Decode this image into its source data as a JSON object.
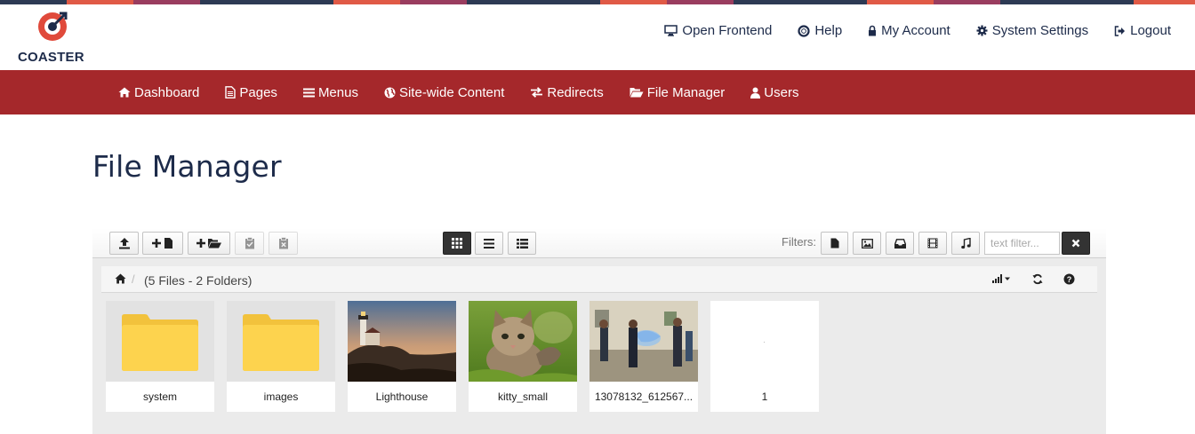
{
  "brand": {
    "logo_text": "COASTER",
    "stripe_colors": [
      "#2d3a54",
      "#e05a46",
      "#9a3d5f",
      "#2d3a54",
      "#2d3a54",
      "#e05a46",
      "#9a3d5f",
      "#2d3a54",
      "#2d3a54",
      "#e05a46",
      "#9a3d5f",
      "#2d3a54",
      "#2d3a54",
      "#e05a46",
      "#9a3d5f",
      "#2d3a54",
      "#2d3a54",
      "#e05a46"
    ]
  },
  "top_links": {
    "open_frontend": "Open Frontend",
    "help": "Help",
    "my_account": "My Account",
    "system_settings": "System Settings",
    "logout": "Logout"
  },
  "nav": {
    "dashboard": "Dashboard",
    "pages": "Pages",
    "menus": "Menus",
    "site_wide_content": "Site-wide Content",
    "redirects": "Redirects",
    "file_manager": "File Manager",
    "users": "Users"
  },
  "page": {
    "title": "File Manager"
  },
  "file_manager": {
    "filters_label": "Filters:",
    "filter_placeholder": "text filter...",
    "summary": "(5 Files - 2 Folders)",
    "items": [
      {
        "name": "system",
        "kind": "folder"
      },
      {
        "name": "images",
        "kind": "folder"
      },
      {
        "name": "Lighthouse",
        "kind": "image"
      },
      {
        "name": "kitty_small",
        "kind": "image"
      },
      {
        "name": "13078132_612567...",
        "kind": "image"
      },
      {
        "name": "1",
        "kind": "file"
      }
    ]
  },
  "colors": {
    "brand_dark": "#1d2b4a",
    "nav_red": "#a5282b",
    "folder_yellow": "#fdd34e"
  }
}
